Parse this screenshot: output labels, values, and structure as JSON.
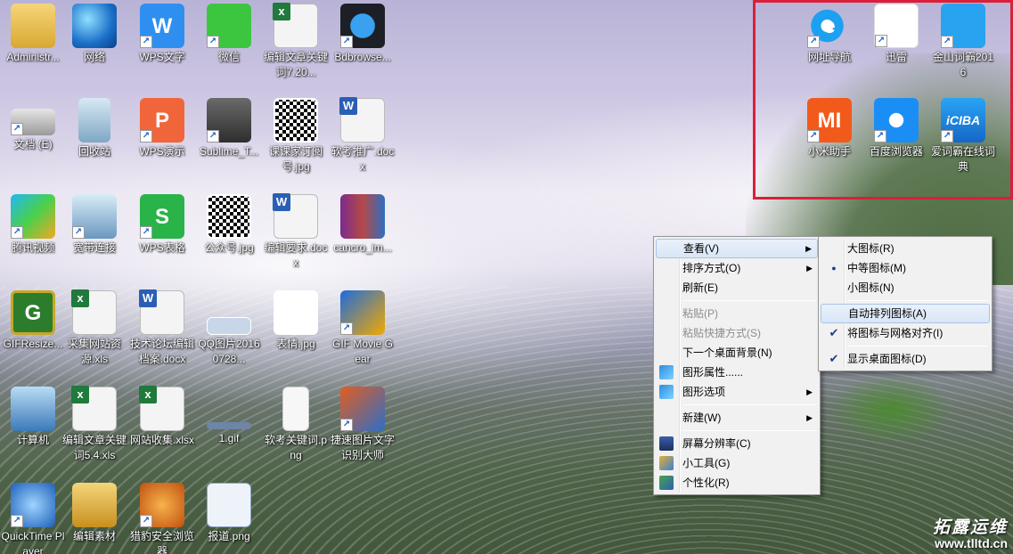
{
  "desktop": {
    "icons": [
      {
        "label": "Administr...",
        "kind": "folder",
        "shortcut": false
      },
      {
        "label": "网络",
        "kind": "globe",
        "shortcut": false
      },
      {
        "label": "WPS文字",
        "kind": "wps-w",
        "glyph": "W",
        "shortcut": true
      },
      {
        "label": "微信",
        "kind": "wechat",
        "shortcut": true
      },
      {
        "label": "编辑文章关键词7.20...",
        "kind": "excel",
        "shortcut": false
      },
      {
        "label": "Bdbrowse...",
        "kind": "bdb",
        "shortcut": true
      },
      {
        "label": "文档 (E)",
        "kind": "drive",
        "shortcut": true
      },
      {
        "label": "回收站",
        "kind": "bin",
        "shortcut": false
      },
      {
        "label": "WPS演示",
        "kind": "wps-p",
        "glyph": "P",
        "shortcut": true
      },
      {
        "label": "Sublime_T...",
        "kind": "sublime",
        "shortcut": true
      },
      {
        "label": "课课家订阅号.jpg",
        "kind": "qr",
        "shortcut": false
      },
      {
        "label": "软考推广.docx",
        "kind": "word",
        "shortcut": false
      },
      {
        "label": "腾讯视频",
        "kind": "tencent",
        "shortcut": true
      },
      {
        "label": "宽带连接",
        "kind": "network",
        "shortcut": true
      },
      {
        "label": "WPS表格",
        "kind": "wps-s",
        "glyph": "S",
        "shortcut": true
      },
      {
        "label": "公众号.jpg",
        "kind": "qr",
        "shortcut": false
      },
      {
        "label": "编辑要求.docx",
        "kind": "word",
        "shortcut": false
      },
      {
        "label": "cancro_im...",
        "kind": "rar",
        "shortcut": false
      },
      {
        "label": "GIFResize...",
        "kind": "gif",
        "glyph": "G",
        "shortcut": false
      },
      {
        "label": "采集网站资源.xls",
        "kind": "excel",
        "shortcut": false
      },
      {
        "label": "技术论坛编辑档案.docx",
        "kind": "word",
        "shortcut": false
      },
      {
        "label": "QQ图片20160728...",
        "kind": "qqimg",
        "shortcut": false
      },
      {
        "label": "表情.jpg",
        "kind": "face",
        "shortcut": false
      },
      {
        "label": "GIF Movie Gear",
        "kind": "gifgear",
        "shortcut": true
      },
      {
        "label": "计算机",
        "kind": "pc",
        "shortcut": false
      },
      {
        "label": "编辑文章关键词5.4.xls",
        "kind": "excel",
        "shortcut": false
      },
      {
        "label": "网站收集.xlsx",
        "kind": "excel",
        "shortcut": false
      },
      {
        "label": "1.gif",
        "kind": "gif1",
        "shortcut": false
      },
      {
        "label": "软考关键词.png",
        "kind": "png",
        "shortcut": false
      },
      {
        "label": "捷速图片文字识别大师",
        "kind": "jt",
        "shortcut": true
      },
      {
        "label": "QuickTime Player",
        "kind": "qt",
        "shortcut": true
      },
      {
        "label": "编辑素材",
        "kind": "edit",
        "shortcut": false
      },
      {
        "label": "猎豹安全浏览器",
        "kind": "cheetah",
        "shortcut": true
      },
      {
        "label": "报道.png",
        "kind": "baodao",
        "shortcut": false
      }
    ],
    "highlighted_icons": [
      {
        "label": "网址导航",
        "kind": "ie",
        "glyph": "e",
        "shortcut": true
      },
      {
        "label": "迅雷",
        "kind": "xunlei",
        "shortcut": true
      },
      {
        "label": "金山词霸2016",
        "kind": "jinshan",
        "shortcut": true
      },
      {
        "label": "小米助手",
        "kind": "mi",
        "glyph": "MI",
        "shortcut": true
      },
      {
        "label": "百度浏览器",
        "kind": "baidu",
        "shortcut": true
      },
      {
        "label": "爱词霸在线词典",
        "kind": "iciba",
        "glyph": "iCIBA",
        "shortcut": true
      }
    ],
    "highlight_color": "#d8203a"
  },
  "context_menu": {
    "items": [
      {
        "label": "查看(V)",
        "submenu": true,
        "active": true
      },
      {
        "label": "排序方式(O)",
        "submenu": true
      },
      {
        "label": "刷新(E)"
      },
      {
        "separator": true
      },
      {
        "label": "粘贴(P)",
        "disabled": true
      },
      {
        "label": "粘贴快捷方式(S)",
        "disabled": true
      },
      {
        "label": "下一个桌面背景(N)"
      },
      {
        "label": "图形属性......",
        "icon": "graphics-properties-icon"
      },
      {
        "label": "图形选项",
        "submenu": true,
        "icon": "graphics-options-icon"
      },
      {
        "separator": true
      },
      {
        "label": "新建(W)",
        "submenu": true
      },
      {
        "separator": true
      },
      {
        "label": "屏幕分辨率(C)",
        "icon": "screen-resolution-icon"
      },
      {
        "label": "小工具(G)",
        "icon": "gadgets-icon"
      },
      {
        "label": "个性化(R)",
        "icon": "personalize-icon"
      }
    ]
  },
  "view_submenu": {
    "items": [
      {
        "label": "大图标(R)"
      },
      {
        "label": "中等图标(M)",
        "mark": "radio"
      },
      {
        "label": "小图标(N)"
      },
      {
        "separator": true
      },
      {
        "label": "自动排列图标(A)",
        "active": true
      },
      {
        "label": "将图标与网格对齐(I)",
        "mark": "check"
      },
      {
        "separator": true
      },
      {
        "label": "显示桌面图标(D)",
        "mark": "check"
      }
    ]
  },
  "watermark": {
    "text": "拓露运维",
    "url": "www.tlltd.cn"
  }
}
